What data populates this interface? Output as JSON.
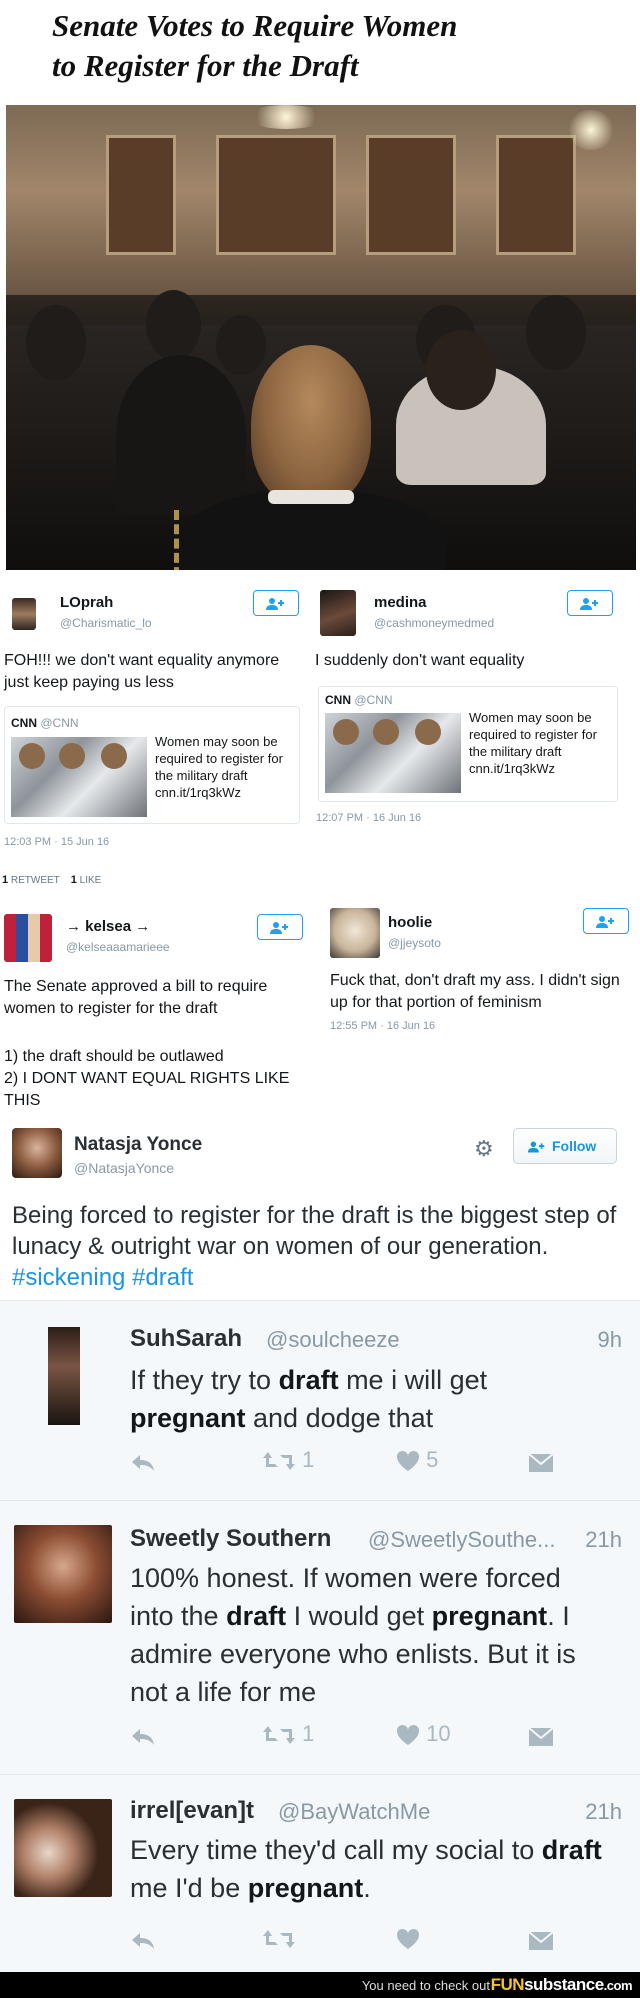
{
  "headline": {
    "line1": "Senate Votes to Require Women",
    "line2": "to Register for the Draft"
  },
  "tweets": [
    {
      "name": "LOprah",
      "handle": "@Charismatic_lo",
      "text": "FOH!!! we don't want equality anymore just keep paying us less",
      "card": {
        "source": "CNN",
        "source_handle": "@CNN",
        "text": "Women may soon be required to register for the military draft cnn.it/1rq3kWz"
      },
      "timestamp": "12:03 PM · 15 Jun 16",
      "retweets": "1",
      "retweets_label": "RETWEET",
      "likes": "1",
      "likes_label": "LIKE"
    },
    {
      "name": "medina",
      "handle": "@cashmoneymedmed",
      "text": "I suddenly don't want equality",
      "card": {
        "source": "CNN",
        "source_handle": "@CNN",
        "text": "Women may soon be required to register for the military draft cnn.it/1rq3kWz"
      },
      "timestamp": "12:07 PM · 16 Jun 16"
    },
    {
      "name": "→ kelsea →",
      "handle": "@kelseaaamarieee",
      "text": "The Senate approved a bill to require women to register for the draft",
      "list": [
        "1) the draft should be outlawed",
        "2) I DONT WANT EQUAL RIGHTS LIKE THIS"
      ]
    },
    {
      "name": "hoolie",
      "handle": "@jjeysoto",
      "text": "Fuck that, don't draft my ass. I didn't sign up for that portion of feminism",
      "timestamp": "12:55 PM · 16 Jun 16"
    }
  ],
  "natasja": {
    "name": "Natasja Yonce",
    "handle": "@NatasjaYonce",
    "follow_label": "Follow",
    "text": "Being forced to register for the draft is the biggest step of lunacy & outright war on women of our generation.",
    "hashtags": "#sickening #draft"
  },
  "mobile_tweets": [
    {
      "name": "SuhSarah",
      "handle": "@soulcheeze",
      "time": "9h",
      "text_parts": [
        "If they try to ",
        "draft",
        " me i will get ",
        "pregnant",
        " and dodge that"
      ],
      "retweets": "1",
      "likes": "5"
    },
    {
      "name": "Sweetly Southern",
      "handle": "@SweetlySouthe...",
      "time": "21h",
      "text_parts": [
        "100% honest. If women were forced into the ",
        "draft",
        " I would get ",
        "pregnant",
        ". I admire everyone who enlists. But it is not a life for me"
      ],
      "retweets": "1",
      "likes": "10"
    },
    {
      "name": "irrel[evan]t",
      "handle": "@BayWatchMe",
      "time": "21h",
      "text_parts": [
        "Every time they'd call my social to ",
        "draft",
        " me I'd be ",
        "pregnant",
        "."
      ],
      "retweets": "",
      "likes": ""
    }
  ],
  "footer": {
    "message": "You need to check out",
    "brand_a": "FUN",
    "brand_b": "substance",
    "brand_c": ".com"
  },
  "colors": {
    "twitter_blue": "#1da1f2",
    "hashtag_blue": "#1b95e0",
    "muted_gray": "#8899a6",
    "brand_yellow": "#f3c42b"
  }
}
